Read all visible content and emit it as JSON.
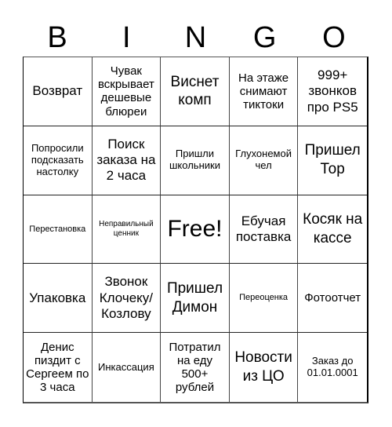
{
  "title_letters": [
    "B",
    "I",
    "N",
    "G",
    "O"
  ],
  "cells": [
    "Возврат",
    "Чувак вскрывает дешевые блюреи",
    "Виснет комп",
    "На этаже снимают тиктоки",
    "999+ звонков про PS5",
    "Попросили подсказать настолку",
    "Поиск заказа на 2 часа",
    "Пришли школьники",
    "Глухонемой чел",
    "Пришел Тор",
    "Перестановка",
    "Неправильный ценник",
    "Free!",
    "Ебучая поставка",
    "Косяк на кассе",
    "Упаковка",
    "Звонок Клочеку/ Козлову",
    "Пришел Димон",
    "Переоценка",
    "Фотоотчет",
    "Денис пиздит с Сергеем по 3 часа",
    "Инкассация",
    "Потратил на еду 500+ рублей",
    "Новости из ЦО",
    "Заказ до 01.01.0001"
  ]
}
